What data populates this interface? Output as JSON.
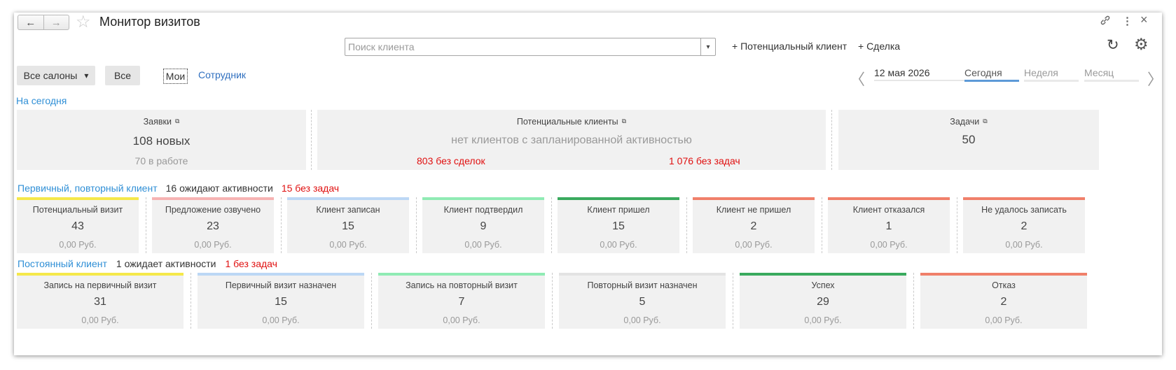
{
  "window": {
    "title": "Монитор визитов",
    "nav": {
      "back_icon": "←",
      "forward_icon": "→"
    },
    "icons": {
      "star": "☆",
      "link": "🔗",
      "menu": "⋮",
      "close": "×",
      "refresh": "↻",
      "gear": "⚙"
    }
  },
  "search": {
    "placeholder": "Поиск клиента",
    "dropdown_icon": "▾"
  },
  "actions": {
    "potential_client": "+ Потенциальный клиент",
    "deal": "+ Сделка"
  },
  "filters": {
    "salons": "Все салоны",
    "salons_arrow": "▾",
    "all": "Все",
    "mine": "Мои",
    "employee": "Сотрудник"
  },
  "period": {
    "prev": "〈",
    "next": "〉",
    "date": "12 мая 2026",
    "tabs": [
      "Сегодня",
      "Неделя",
      "Месяц"
    ],
    "active_tab": "Сегодня"
  },
  "today": {
    "header": "На сегодня",
    "requests": {
      "title": "Заявки",
      "new": "108 новых",
      "in_work": "70 в работе"
    },
    "potential": {
      "title": "Потенциальные клиенты",
      "message": "нет клиентов с запланированной активностью",
      "no_deals": "803 без сделок",
      "no_tasks": "1 076 без задач"
    },
    "tasks": {
      "title": "Задачи",
      "count": "50"
    }
  },
  "primary": {
    "header": "Первичный, повторный клиент",
    "waiting": "16 ожидают активности",
    "no_tasks": "15 без задач",
    "cards": [
      {
        "title": "Потенциальный визит",
        "count": "43",
        "sum": "0,00  Руб.",
        "color": "#f5e84a"
      },
      {
        "title": "Предложение озвучено",
        "count": "23",
        "sum": "0,00  Руб.",
        "color": "#f6b3b3"
      },
      {
        "title": "Клиент записан",
        "count": "15",
        "sum": "0,00  Руб.",
        "color": "#bcd7f5"
      },
      {
        "title": "Клиент подтвердил",
        "count": "9",
        "sum": "0,00  Руб.",
        "color": "#90ebb4"
      },
      {
        "title": "Клиент пришел",
        "count": "15",
        "sum": "0,00  Руб.",
        "color": "#3aaa5e"
      },
      {
        "title": "Клиент не пришел",
        "count": "2",
        "sum": "0,00  Руб.",
        "color": "#f0806a"
      },
      {
        "title": "Клиент отказался",
        "count": "1",
        "sum": "0,00  Руб.",
        "color": "#f0806a"
      },
      {
        "title": "Не удалось записать",
        "count": "2",
        "sum": "0,00  Руб.",
        "color": "#f0806a"
      }
    ]
  },
  "permanent": {
    "header": "Постоянный клиент",
    "waiting": "1 ожидает активности",
    "no_tasks": "1 без задач",
    "cards": [
      {
        "title": "Запись на первичный визит",
        "count": "31",
        "sum": "0,00  Руб.",
        "color": "#f5e84a"
      },
      {
        "title": "Первичный визит назначен",
        "count": "15",
        "sum": "0,00  Руб.",
        "color": "#bcd7f5"
      },
      {
        "title": "Запись на повторный визит",
        "count": "7",
        "sum": "0,00  Руб.",
        "color": "#90ebb4"
      },
      {
        "title": "Повторный визит назначен",
        "count": "5",
        "sum": "0,00  Руб.",
        "color": "#e3e3e3"
      },
      {
        "title": "Успех",
        "count": "29",
        "sum": "0,00  Руб.",
        "color": "#3aaa5e"
      },
      {
        "title": "Отказ",
        "count": "2",
        "sum": "0,00  Руб.",
        "color": "#f0806a"
      }
    ]
  }
}
